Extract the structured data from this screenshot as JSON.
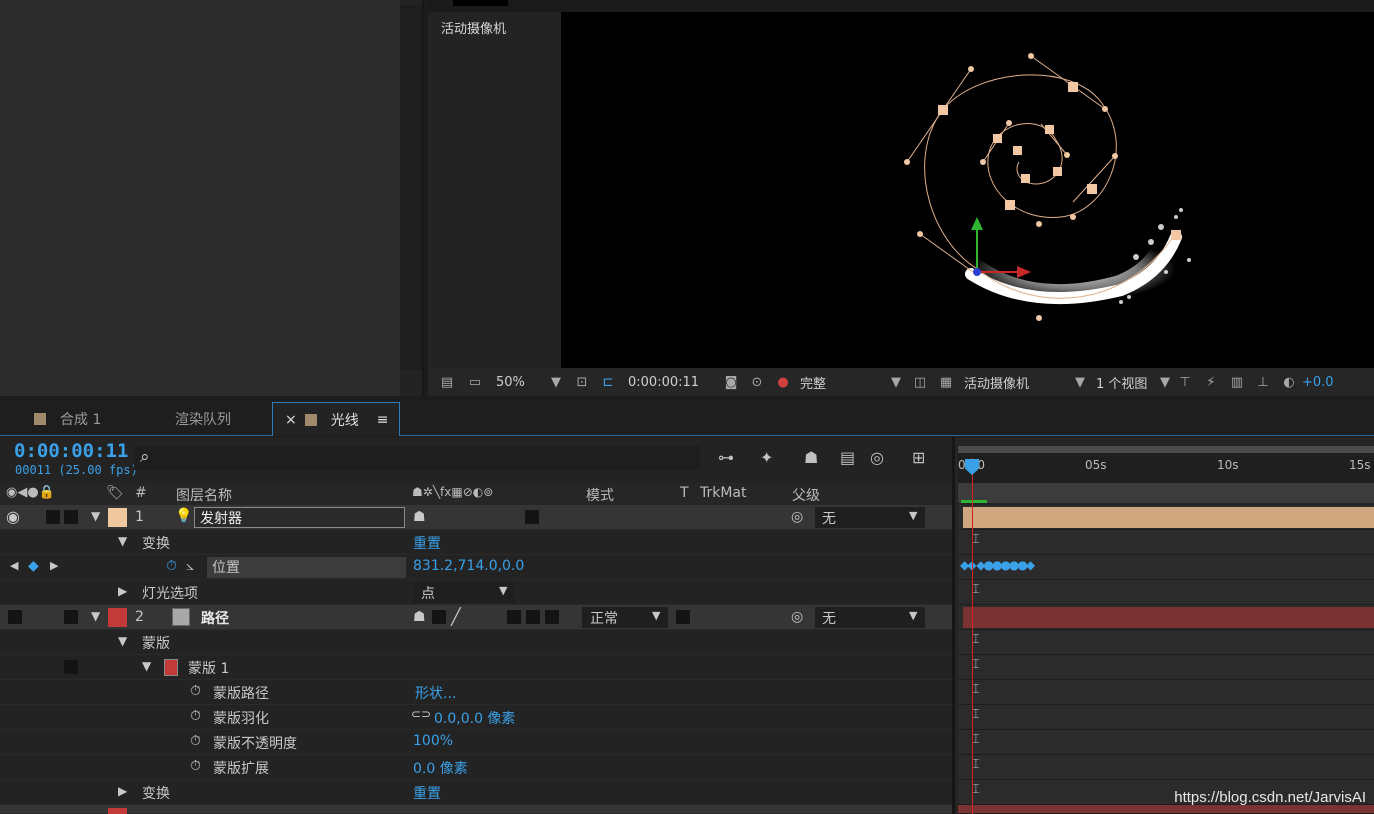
{
  "viewer": {
    "camera_label": "活动摄像机",
    "zoom": "50%",
    "timecode": "0:00:00:11",
    "resolution": "完整",
    "camera_select": "活动摄像机",
    "views_select": "1 个视图",
    "exposure": "+0.0"
  },
  "panel_tabs": {
    "tab1": "合成 1",
    "tab2": "渲染队列",
    "tab3_close": "×",
    "tab3": "光线",
    "tab3_menu": "≡"
  },
  "timeline": {
    "timecode": "0:00:00:11",
    "frames": "00011 (25.00 fps)",
    "search_icon": "⌕",
    "ruler": [
      "0:00",
      "05s",
      "10s",
      "15s"
    ]
  },
  "columns": {
    "hash": "#",
    "layer_name": "图层名称",
    "mode": "模式",
    "t": "T",
    "trkmat": "TrkMat",
    "parent": "父级"
  },
  "rows": {
    "layer1_num": "1",
    "layer1_name": "发射器",
    "layer1_parent": "无",
    "transform1": "变换",
    "transform1_value": "重置",
    "position_label": "位置",
    "position_value": "831.2,714.0,0.0",
    "light_options": "灯光选项",
    "light_options_value": "点",
    "layer2_num": "2",
    "layer2_name": "路径",
    "layer2_mode": "正常",
    "layer2_parent": "无",
    "masks": "蒙版",
    "mask1": "蒙版 1",
    "mask_path": "蒙版路径",
    "mask_path_value": "形状...",
    "mask_feather": "蒙版羽化",
    "mask_feather_value": "0.0,0.0 像素",
    "mask_opacity": "蒙版不透明度",
    "mask_opacity_value": "100%",
    "mask_expansion": "蒙版扩展",
    "mask_expansion_value": "0.0 像素",
    "transform2": "变换",
    "transform2_value": "重置"
  },
  "watermark": "https://blog.csdn.net/JarvisAI",
  "colors": {
    "accent_blue": "#3aa0e8",
    "layer1_swatch": "#f0c8a0",
    "layer2_swatch": "#c23a3a",
    "playhead": "#d42222"
  }
}
